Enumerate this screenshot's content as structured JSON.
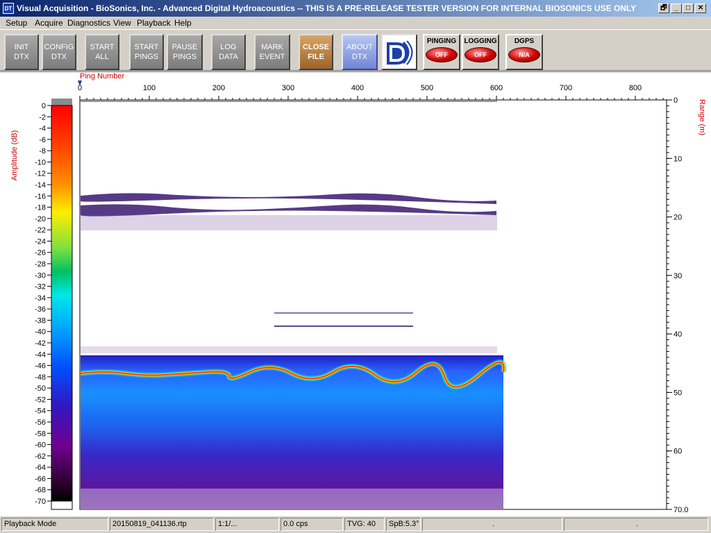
{
  "window": {
    "title": "Visual Acquisition  -  BioSonics, Inc.  -  Advanced Digital Hydroacoustics  -- THIS IS A PRE-RELEASE TESTER VERSION FOR INTERNAL BIOSONICS USE ONLY",
    "icon_text": "DT",
    "controls": {
      "restore": "🗗",
      "minimize": "_",
      "maximize": "□",
      "close": "✕"
    }
  },
  "menu": [
    "Setup",
    "Acquire",
    "Diagnostics",
    "View",
    "Playback",
    "Help"
  ],
  "toolbar": {
    "init_dtx": "INIT\nDTX",
    "config_dtx": "CONFIG\nDTX",
    "start_all": "START\nALL",
    "start_pings": "START\nPINGS",
    "pause_pings": "PAUSE\nPINGS",
    "log_data": "LOG\nDATA",
    "mark_event": "MARK\nEVENT",
    "close_file": "CLOSE\nFILE",
    "about_dtx": "ABOUT\nDTX",
    "logo_icon": "biosonics-logo-icon",
    "pinging_label": "PINGING",
    "pinging_state": "OFF",
    "logging_label": "LOGGING",
    "logging_state": "OFF",
    "dgps_label": "DGPS",
    "dgps_state": "N/A"
  },
  "plot": {
    "x_axis_label": "Ping Number",
    "x_ticks": [
      "0",
      "100",
      "200",
      "300",
      "400",
      "500",
      "600",
      "700",
      "800"
    ],
    "y_axis_label": "Range (m)",
    "y_ticks": [
      "0",
      "10",
      "20",
      "30",
      "40",
      "50",
      "60",
      "70.0"
    ],
    "colorbar_label": "Amplitude (dB)",
    "colorbar_ticks": [
      "0",
      "-2",
      "-4",
      "-6",
      "-8",
      "-10",
      "-12",
      "-14",
      "-16",
      "-18",
      "-20",
      "-22",
      "-24",
      "-26",
      "-28",
      "-30",
      "-32",
      "-34",
      "-36",
      "-38",
      "-40",
      "-42",
      "-44",
      "-46",
      "-48",
      "-50",
      "-52",
      "-54",
      "-56",
      "-58",
      "-60",
      "-62",
      "-64",
      "-66",
      "-68",
      "-70"
    ],
    "colors": {
      "label": "#cc0000",
      "bottom_line": "#ff4000",
      "cursor": "#1c3fa8"
    }
  },
  "status": {
    "mode": "Playback Mode",
    "file": "20150819_041136.rtp",
    "ratio": "1:1/...",
    "rate": "0.0 cps",
    "tvg": "TVG: 40",
    "spb": "SpB:5.3°",
    "p1": ".",
    "p2": "."
  }
}
